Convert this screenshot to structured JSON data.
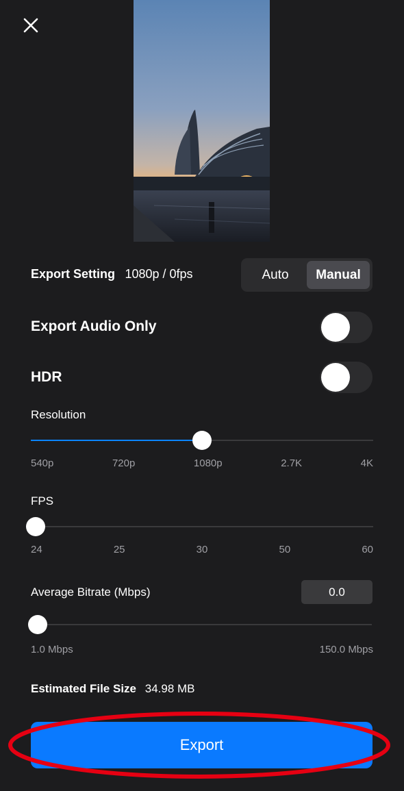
{
  "close": {
    "icon": "close-icon"
  },
  "export_setting": {
    "label": "Export Setting",
    "value": "1080p / 0fps"
  },
  "mode": {
    "options": [
      "Auto",
      "Manual"
    ],
    "selected": "Manual"
  },
  "audio_only": {
    "label": "Export Audio Only",
    "on": false
  },
  "hdr": {
    "label": "HDR",
    "on": false
  },
  "resolution": {
    "label": "Resolution",
    "ticks": [
      "540p",
      "720p",
      "1080p",
      "2.7K",
      "4K"
    ],
    "selected": "1080p"
  },
  "fps": {
    "label": "FPS",
    "ticks": [
      "24",
      "25",
      "30",
      "50",
      "60"
    ],
    "selected": "24"
  },
  "bitrate": {
    "label": "Average Bitrate (Mbps)",
    "value": "0.0",
    "min_label": "1.0 Mbps",
    "max_label": "150.0 Mbps"
  },
  "file_size": {
    "label": "Estimated File Size",
    "value": "34.98 MB"
  },
  "export_button": {
    "label": "Export"
  },
  "colors": {
    "accent": "#0a7aff",
    "background": "#1c1c1e",
    "annotation": "#e60012"
  }
}
